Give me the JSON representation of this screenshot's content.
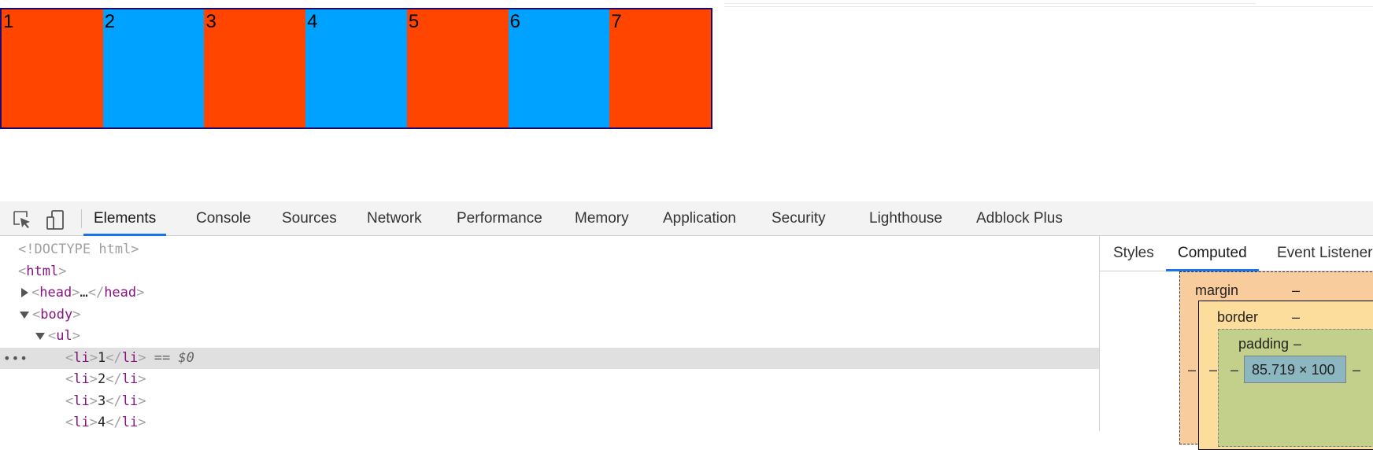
{
  "page": {
    "list_items": [
      {
        "label": "1",
        "color": "#ff4500"
      },
      {
        "label": "2",
        "color": "#00a2ff"
      },
      {
        "label": "3",
        "color": "#ff4500"
      },
      {
        "label": "4",
        "color": "#00a2ff"
      },
      {
        "label": "5",
        "color": "#ff4500"
      },
      {
        "label": "6",
        "color": "#00a2ff"
      },
      {
        "label": "7",
        "color": "#ff4500"
      }
    ],
    "list_border_color": "#1c0a6e"
  },
  "devtools": {
    "toolbar_icons": [
      "inspect-element-icon",
      "device-toolbar-icon"
    ],
    "tabs": [
      "Elements",
      "Console",
      "Sources",
      "Network",
      "Performance",
      "Memory",
      "Application",
      "Security",
      "Lighthouse",
      "Adblock Plus"
    ],
    "active_tab": "Elements",
    "accent_color": "#1a73e8",
    "dom": {
      "doctype": "<!DOCTYPE html>",
      "html_tag": "html",
      "head_tag": "head",
      "head_ellipsis": "…",
      "body_tag": "body",
      "ul_tag": "ul",
      "li_tag": "li",
      "li_texts": [
        "1",
        "2",
        "3",
        "4"
      ],
      "selected_hint": "== $0",
      "row_dots": "•••"
    },
    "sidebar": {
      "tabs": [
        "Styles",
        "Computed",
        "Event Listeners"
      ],
      "active_tab": "Computed",
      "box_model": {
        "margin_label": "margin",
        "margin_value": "–",
        "border_label": "border",
        "border_value": "–",
        "padding_label": "padding",
        "padding_value": "–",
        "dash": "–",
        "content_size": "85.719 × 100"
      }
    }
  }
}
